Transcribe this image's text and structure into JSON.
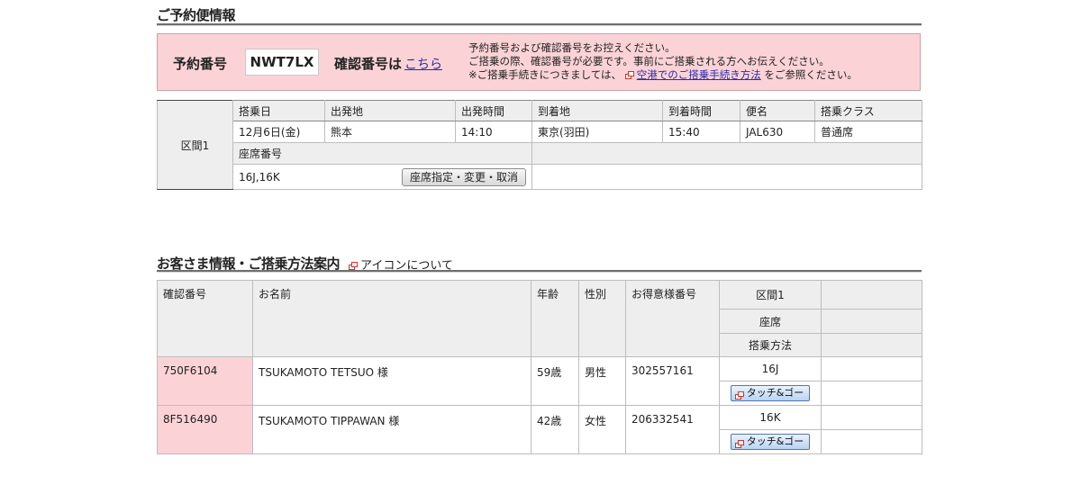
{
  "section1": {
    "title": "ご予約便情報"
  },
  "reservation": {
    "number_label": "予約番号",
    "number_value": "NWT7LX",
    "confirm_label": "確認番号は",
    "confirm_link": "こちら",
    "note_line1": "予約番号および確認番号をお控えください。",
    "note_line2": "ご搭乗の際、確認番号が必要です。事前にご搭乗される方へお伝えください。",
    "note_line3_prefix": "※ご搭乗手続きにつきましては、",
    "note_line3_link": "空港でのご搭乗手続き方法",
    "note_line3_suffix": "をご参照ください。"
  },
  "flight": {
    "section_label": "区間1",
    "headers": [
      "搭乗日",
      "出発地",
      "出発時間",
      "到着地",
      "到着時間",
      "便名",
      "搭乗クラス"
    ],
    "row": [
      "12月6日(金)",
      "熊本",
      "14:10",
      "東京(羽田)",
      "15:40",
      "JAL630",
      "普通席"
    ],
    "seat_label": "座席番号",
    "seat_value": "16J,16K",
    "seat_button": "座席指定・変更・取消"
  },
  "section2": {
    "title": "お客さま情報・ご搭乗方法案内",
    "icon_link": "アイコンについて"
  },
  "passengers": {
    "headers": {
      "confirm": "確認番号",
      "name": "お名前",
      "age": "年齢",
      "gender": "性別",
      "mileage": "お得意様番号",
      "segment": "区間1",
      "seat": "座席",
      "boarding": "搭乗方法"
    },
    "rows": [
      {
        "confirm": "750F6104",
        "name": "TSUKAMOTO TETSUO 様",
        "age": "59歳",
        "gender": "男性",
        "mileage": "302557161",
        "seat": "16J",
        "boarding": "タッチ&ゴー"
      },
      {
        "confirm": "8F516490",
        "name": "TSUKAMOTO TIPPAWAN 様",
        "age": "42歳",
        "gender": "女性",
        "mileage": "206332541",
        "seat": "16K",
        "boarding": "タッチ&ゴー"
      }
    ]
  },
  "colors": {
    "pink": "#fbd3d6",
    "header_gray": "#eeeeee",
    "link": "#2a2ab0",
    "icon_red": "#d2302c"
  }
}
